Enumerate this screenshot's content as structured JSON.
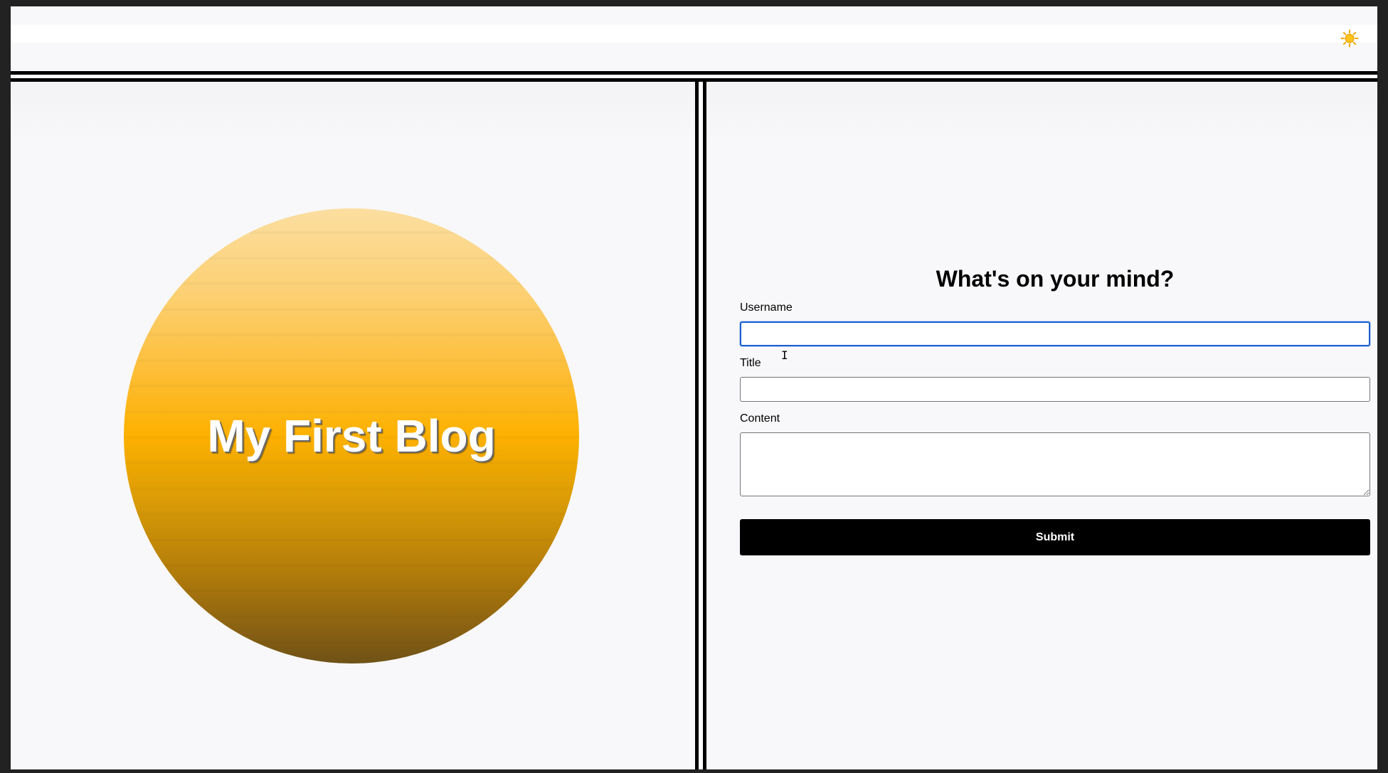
{
  "header": {
    "theme_toggle_icon": "sun-icon",
    "theme_toggle_glyph": "☀"
  },
  "hero": {
    "title": "My First Blog",
    "gradient_top": "#fbdea0",
    "gradient_mid": "#fdb100",
    "gradient_bottom": "#6f5217"
  },
  "form": {
    "heading": "What's on your mind?",
    "username_label": "Username",
    "username_value": "",
    "title_label": "Title",
    "title_value": "",
    "content_label": "Content",
    "content_value": "",
    "submit_label": "Submit",
    "focus_color": "#1a5fd0"
  },
  "cursor": {
    "glyph": "I",
    "icon": "text-cursor-icon"
  }
}
